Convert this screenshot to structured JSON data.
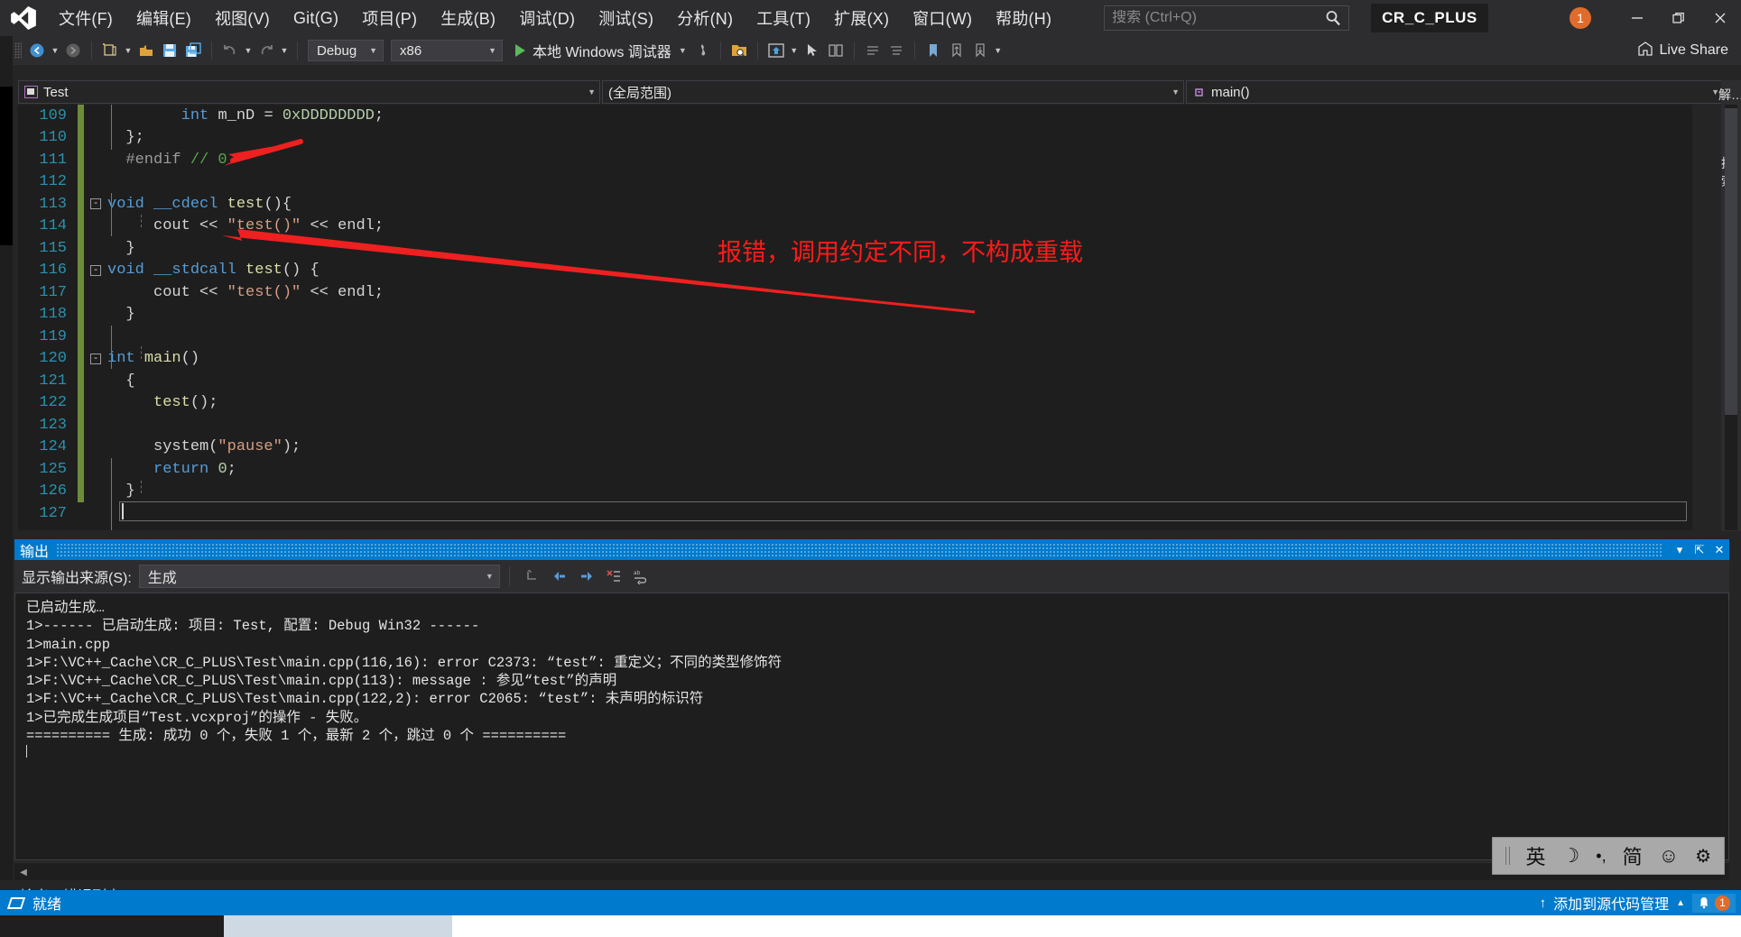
{
  "window": {
    "project_badge": "CR_C_PLUS",
    "notification_count": "1"
  },
  "menu": {
    "items": [
      {
        "label": "文件(F)",
        "name": "menu-file"
      },
      {
        "label": "编辑(E)",
        "name": "menu-edit"
      },
      {
        "label": "视图(V)",
        "name": "menu-view"
      },
      {
        "label": "Git(G)",
        "name": "menu-git"
      },
      {
        "label": "项目(P)",
        "name": "menu-project"
      },
      {
        "label": "生成(B)",
        "name": "menu-build"
      },
      {
        "label": "调试(D)",
        "name": "menu-debug"
      },
      {
        "label": "测试(S)",
        "name": "menu-test"
      },
      {
        "label": "分析(N)",
        "name": "menu-analyze"
      },
      {
        "label": "工具(T)",
        "name": "menu-tools"
      },
      {
        "label": "扩展(X)",
        "name": "menu-extensions"
      },
      {
        "label": "窗口(W)",
        "name": "menu-window"
      },
      {
        "label": "帮助(H)",
        "name": "menu-help"
      }
    ],
    "search_placeholder": "搜索 (Ctrl+Q)",
    "search_value": ""
  },
  "toolbar": {
    "config": "Debug",
    "platform": "x86",
    "run_label": "本地 Windows 调试器",
    "live_share": "Live Share"
  },
  "navbar": {
    "project": "Test",
    "scope": "(全局范围)",
    "member": "main()"
  },
  "editor": {
    "lines": [
      {
        "num": "109",
        "changed": true,
        "fold": "",
        "indent": 2,
        "tokens": [
          {
            "t": "        ",
            "c": "pl"
          },
          {
            "t": "int",
            "c": "k"
          },
          {
            "t": " ",
            "c": "pl"
          },
          {
            "t": "m_nD",
            "c": "pl"
          },
          {
            "t": " = ",
            "c": "pl"
          },
          {
            "t": "0xDDDDDDDD",
            "c": "nm"
          },
          {
            "t": ";",
            "c": "pl"
          }
        ]
      },
      {
        "num": "110",
        "changed": true,
        "fold": "",
        "indent": 1,
        "tokens": [
          {
            "t": "  };",
            "c": "pl"
          }
        ]
      },
      {
        "num": "111",
        "changed": true,
        "fold": "",
        "indent": 0,
        "tokens": [
          {
            "t": "  #endif ",
            "c": "pp"
          },
          {
            "t": "// 0",
            "c": "cm"
          }
        ]
      },
      {
        "num": "112",
        "changed": true,
        "fold": "",
        "indent": 0,
        "tokens": []
      },
      {
        "num": "113",
        "changed": true,
        "fold": "-",
        "indent": 0,
        "tokens": [
          {
            "t": "void",
            "c": "k"
          },
          {
            "t": " ",
            "c": "pl"
          },
          {
            "t": "__cdecl",
            "c": "k"
          },
          {
            "t": " ",
            "c": "pl"
          },
          {
            "t": "test",
            "c": "fn"
          },
          {
            "t": "(){",
            "c": "pl"
          }
        ]
      },
      {
        "num": "114",
        "changed": true,
        "fold": "",
        "indent": 1,
        "tokens": [
          {
            "t": "     cout ",
            "c": "pl"
          },
          {
            "t": "<<",
            "c": "pl"
          },
          {
            "t": " \"test()\" ",
            "c": "st"
          },
          {
            "t": "<<",
            "c": "pl"
          },
          {
            "t": " endl;",
            "c": "pl"
          }
        ]
      },
      {
        "num": "115",
        "changed": true,
        "fold": "",
        "indent": 0,
        "tokens": [
          {
            "t": "  }",
            "c": "pl"
          }
        ]
      },
      {
        "num": "116",
        "changed": true,
        "fold": "-",
        "indent": 0,
        "tokens": [
          {
            "t": "void",
            "c": "k"
          },
          {
            "t": " ",
            "c": "pl"
          },
          {
            "t": "__stdcall",
            "c": "k"
          },
          {
            "t": " ",
            "c": "pl"
          },
          {
            "t": "test",
            "c": "fn"
          },
          {
            "t": "() {",
            "c": "pl"
          }
        ]
      },
      {
        "num": "117",
        "changed": true,
        "fold": "",
        "indent": 1,
        "tokens": [
          {
            "t": "     cout ",
            "c": "pl"
          },
          {
            "t": "<<",
            "c": "pl"
          },
          {
            "t": " \"test()\" ",
            "c": "st"
          },
          {
            "t": "<<",
            "c": "pl"
          },
          {
            "t": " endl;",
            "c": "pl"
          }
        ]
      },
      {
        "num": "118",
        "changed": true,
        "fold": "",
        "indent": 0,
        "tokens": [
          {
            "t": "  }",
            "c": "pl"
          }
        ]
      },
      {
        "num": "119",
        "changed": true,
        "fold": "",
        "indent": 0,
        "tokens": []
      },
      {
        "num": "120",
        "changed": true,
        "fold": "-",
        "indent": 0,
        "tokens": [
          {
            "t": "int",
            "c": "k"
          },
          {
            "t": " ",
            "c": "pl"
          },
          {
            "t": "main",
            "c": "fn"
          },
          {
            "t": "()",
            "c": "pl"
          }
        ]
      },
      {
        "num": "121",
        "changed": true,
        "fold": "",
        "indent": 0,
        "tokens": [
          {
            "t": "  {",
            "c": "pl"
          }
        ]
      },
      {
        "num": "122",
        "changed": true,
        "fold": "",
        "indent": 1,
        "tokens": [
          {
            "t": "     ",
            "c": "pl"
          },
          {
            "t": "test",
            "c": "fn"
          },
          {
            "t": "();",
            "c": "pl"
          }
        ]
      },
      {
        "num": "123",
        "changed": true,
        "fold": "",
        "indent": 1,
        "tokens": []
      },
      {
        "num": "124",
        "changed": true,
        "fold": "",
        "indent": 1,
        "tokens": [
          {
            "t": "     system(",
            "c": "pl"
          },
          {
            "t": "\"pause\"",
            "c": "st"
          },
          {
            "t": ");",
            "c": "pl"
          }
        ]
      },
      {
        "num": "125",
        "changed": true,
        "fold": "",
        "indent": 1,
        "tokens": [
          {
            "t": "     ",
            "c": "pl"
          },
          {
            "t": "return",
            "c": "k"
          },
          {
            "t": " ",
            "c": "pl"
          },
          {
            "t": "0",
            "c": "nm"
          },
          {
            "t": ";",
            "c": "pl"
          }
        ]
      },
      {
        "num": "126",
        "changed": true,
        "fold": "",
        "indent": 0,
        "tokens": [
          {
            "t": "  }",
            "c": "pl"
          }
        ]
      },
      {
        "num": "127",
        "changed": false,
        "fold": "",
        "indent": 0,
        "tokens": []
      }
    ]
  },
  "annotation": {
    "text": "报错，调用约定不同，不构成重载",
    "color": "#ff1a1a"
  },
  "output": {
    "panel_title": "输出",
    "source_label": "显示输出来源(S):",
    "source_value": "生成",
    "lines": [
      "已启动生成…",
      "1>------ 已启动生成: 项目: Test, 配置: Debug Win32 ------",
      "1>main.cpp",
      "1>F:\\VC++_Cache\\CR_C_PLUS\\Test\\main.cpp(116,16): error C2373: “test”: 重定义；不同的类型修饰符",
      "1>F:\\VC++_Cache\\CR_C_PLUS\\Test\\main.cpp(113): message : 参见“test”的声明",
      "1>F:\\VC++_Cache\\CR_C_PLUS\\Test\\main.cpp(122,2): error C2065: “test”: 未声明的标识符",
      "1>已完成生成项目“Test.vcxproj”的操作 - 失败。",
      "========== 生成: 成功 0 个，失败 1 个，最新 2 个，跳过 0 个 =========="
    ]
  },
  "bottom_tabs": [
    {
      "label": "输出",
      "selected": true
    },
    {
      "label": "错误列表",
      "selected": false
    }
  ],
  "statusbar": {
    "status": "就绪",
    "source_control": "添加到源代码管理",
    "error_count": "1"
  },
  "ime": {
    "lang": "英",
    "shape": "☽",
    "punct": "•,",
    "simplified": "简",
    "emoji": "☺",
    "settings": "⚙"
  },
  "right_rail": {
    "labels": [
      "解…",
      "搜索"
    ]
  },
  "colors": {
    "accent": "#007acc",
    "titlebar": "#2d2d30",
    "editor_bg": "#1e1e1e",
    "keyword": "#569cd6",
    "function": "#dcdcaa",
    "string": "#d69d85",
    "comment": "#57a64a",
    "linenum": "#2b91af",
    "annotation": "#ff1a1a",
    "badge": "#e06c2b"
  }
}
